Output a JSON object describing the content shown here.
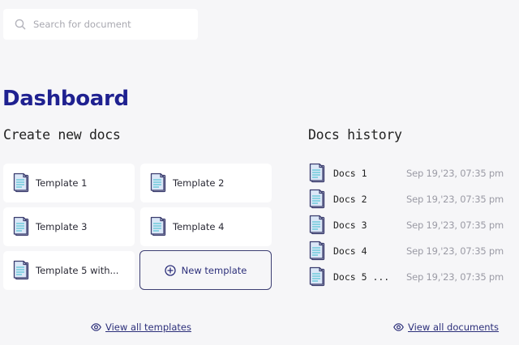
{
  "search": {
    "placeholder": "Search for document",
    "icon": "search-icon"
  },
  "page_title": "Dashboard",
  "create": {
    "title": "Create new docs",
    "templates": [
      {
        "label": "Template 1"
      },
      {
        "label": "Template 2"
      },
      {
        "label": "Template 3"
      },
      {
        "label": "Template 4"
      },
      {
        "label": "Template 5 with..."
      }
    ],
    "new_template_label": "New template",
    "view_all_label": "View all templates"
  },
  "history": {
    "title": "Docs history",
    "docs": [
      {
        "name": "Docs 1",
        "date": "Sep 19,'23, 07:35 pm"
      },
      {
        "name": "Docs 2",
        "date": "Sep 19,'23, 07:35 pm"
      },
      {
        "name": "Docs 3",
        "date": "Sep 19,'23, 07:35 pm"
      },
      {
        "name": "Docs 4",
        "date": "Sep 19,'23, 07:35 pm"
      },
      {
        "name": "Docs 5 ...",
        "date": "Sep 19,'23, 07:35 pm"
      }
    ],
    "view_all_label": "View all documents"
  },
  "colors": {
    "brand": "#1f2190",
    "link": "#2c2f7a",
    "background": "#f6f6f8",
    "doc_icon_fill": "#dbe7f7",
    "doc_icon_line": "#5fc7d6"
  }
}
